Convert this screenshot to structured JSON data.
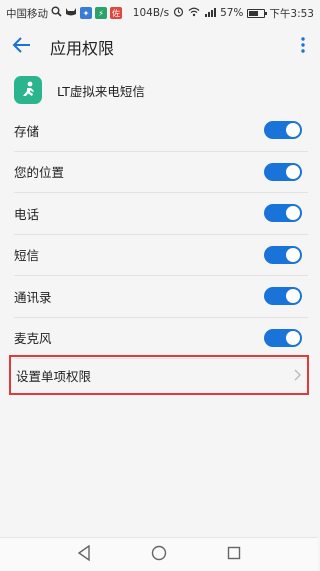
{
  "status_bar": {
    "carrier": "中国移动",
    "network_speed": "104B/s",
    "battery": "57%",
    "time": "下午3:53",
    "notification_icons": [
      "search-icon",
      "cat-icon",
      "app-icon-blue",
      "app-icon-green",
      "app-icon-red"
    ]
  },
  "app_bar": {
    "title": "应用权限"
  },
  "app": {
    "name": "LT虚拟来电短信",
    "icon_color": "#2ab58e"
  },
  "permissions": [
    {
      "label": "存储",
      "enabled": true
    },
    {
      "label": "您的位置",
      "enabled": true
    },
    {
      "label": "电话",
      "enabled": true
    },
    {
      "label": "短信",
      "enabled": true
    },
    {
      "label": "通讯录",
      "enabled": true
    },
    {
      "label": "麦克风",
      "enabled": true
    }
  ],
  "single_permission": {
    "label": "设置单项权限"
  },
  "colors": {
    "accent": "#1a73d9",
    "highlight_border": "#e03a3a"
  }
}
